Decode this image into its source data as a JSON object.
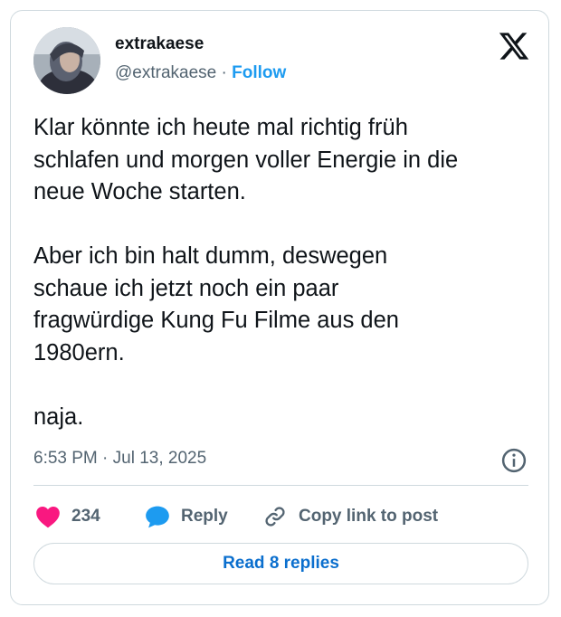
{
  "author": {
    "name": "extrakaese",
    "handle": "@extrakaese",
    "separator": "·",
    "follow_label": "Follow"
  },
  "tweet": {
    "paragraphs": [
      [
        "Klar könnte ich heute mal richtig früh",
        "schlafen und morgen voller Energie in die",
        "neue Woche starten."
      ],
      [
        "Aber ich bin halt dumm, deswegen",
        "schaue ich jetzt noch ein paar",
        "fragwürdige Kung Fu Filme aus den",
        "1980ern."
      ],
      [
        "naja."
      ]
    ],
    "timestamp": "6:53 PM · Jul 13, 2025"
  },
  "actions": {
    "likes_count": "234",
    "reply_label": "Reply",
    "copy_link_label": "Copy link to post"
  },
  "read_replies_label": "Read 8 replies",
  "colors": {
    "accent": "#1d9bf0",
    "like": "#f91880",
    "muted": "#536471",
    "border": "#cfd9de"
  },
  "icons": [
    "avatar",
    "x-logo-icon",
    "info-icon",
    "heart-icon",
    "reply-bubble-icon",
    "link-icon"
  ]
}
